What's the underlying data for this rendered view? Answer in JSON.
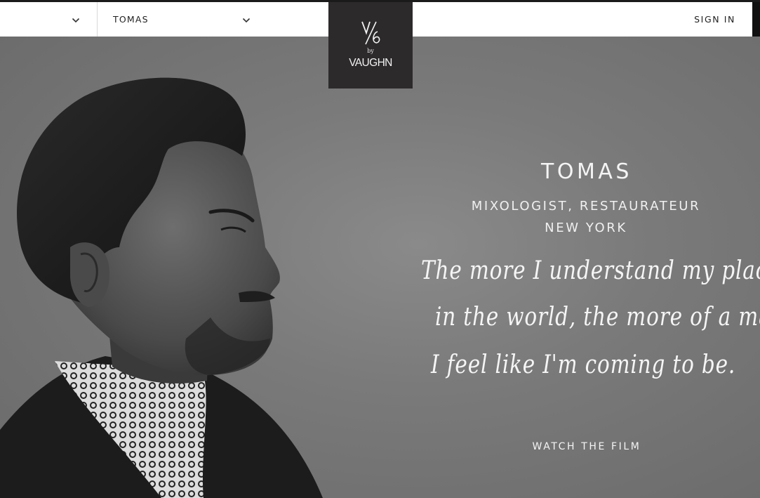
{
  "nav": {
    "dropdown_one": "",
    "dropdown_two": "TOMAS",
    "sign_in": "SIGN IN"
  },
  "logo": {
    "mark": "V/6",
    "by": "by",
    "brand": "VAUGHN"
  },
  "hero": {
    "name": "TOMAS",
    "role": "MIXOLOGIST, RESTAURATEUR",
    "city": "NEW YORK",
    "quote_lines": [
      "The more I understand my place",
      "in the world, the more of a man",
      "I feel like I'm coming to be."
    ],
    "cta": "WATCH THE FILM"
  },
  "colors": {
    "nav_bg": "#ffffff",
    "logo_bg": "#2d2a2b",
    "hero_bg": "#7a7a7a",
    "hero_text": "#f4f4f4"
  },
  "icons": {
    "dropdown": "chevron-down-icon"
  }
}
